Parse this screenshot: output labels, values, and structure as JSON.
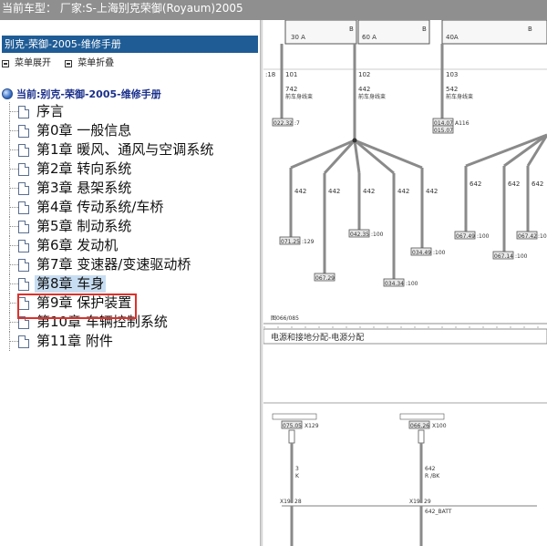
{
  "topbar": {
    "label": "当前车型：",
    "value": "厂家:S-上海别克荣御(Royaum)2005"
  },
  "left": {
    "book_title": "别克-荣御-2005-维修手册",
    "controls": {
      "expand": "菜单展开",
      "collapse": "菜单折叠"
    },
    "current": "当前:别克-荣御-2005-维修手册",
    "tree": [
      {
        "label": "序言",
        "selected": false
      },
      {
        "label": "第0章 一般信息",
        "selected": false
      },
      {
        "label": "第1章 暖风、通风与空调系统",
        "selected": false
      },
      {
        "label": "第2章 转向系统",
        "selected": false
      },
      {
        "label": "第3章 悬架系统",
        "selected": false
      },
      {
        "label": "第4章 传动系统/车桥",
        "selected": false
      },
      {
        "label": "第5章 制动系统",
        "selected": false
      },
      {
        "label": "第6章 发动机",
        "selected": false
      },
      {
        "label": "第7章 变速器/变速驱动桥",
        "selected": false
      },
      {
        "label": "第8章 车身",
        "selected": true
      },
      {
        "label": "第9章 保护装置",
        "selected": false
      },
      {
        "label": "第10章 车辆控制系统",
        "selected": false
      },
      {
        "label": "第11章 附件",
        "selected": false
      }
    ]
  },
  "diagram": {
    "fuses": [
      {
        "amp": "30 A",
        "pin": "B"
      },
      {
        "amp": "60 A",
        "pin": "B"
      },
      {
        "amp": "40A",
        "pin": "B"
      }
    ],
    "wire_labels": {
      "w101": "101",
      "w102": "102",
      "w103": "103",
      "w742": "742",
      "w442": "442",
      "w542": "542",
      "w642": "642",
      "harness": "前车身线束",
      "pin18": ":18"
    },
    "connectors": {
      "c1": "022.32",
      "c2": "071.25",
      "c3": "067.29",
      "c4": "042.35",
      "c5": "034.34",
      "c6": "034.49",
      "c7": "014.07",
      "c8": "015.07",
      "c9": "067.49",
      "c10": "067.14",
      "c11": "067.42",
      "a116": "A116",
      "v7": ":7",
      "v129": ":129",
      "v100": ":100"
    },
    "grid_ref": "图066/085",
    "section_title": "电源和接地分配-电源分配",
    "lower": {
      "box1_ref": "075.05",
      "box1_pin": "X129",
      "box2_ref": "066.26",
      "box2_pin": "X100",
      "wire1_num": "3",
      "wire1_color": "K",
      "wire2_num": "642",
      "wire2_color": "R /BK",
      "x19": "X19",
      "p28": "28",
      "p29": "29",
      "batt": "642_BATT"
    }
  }
}
